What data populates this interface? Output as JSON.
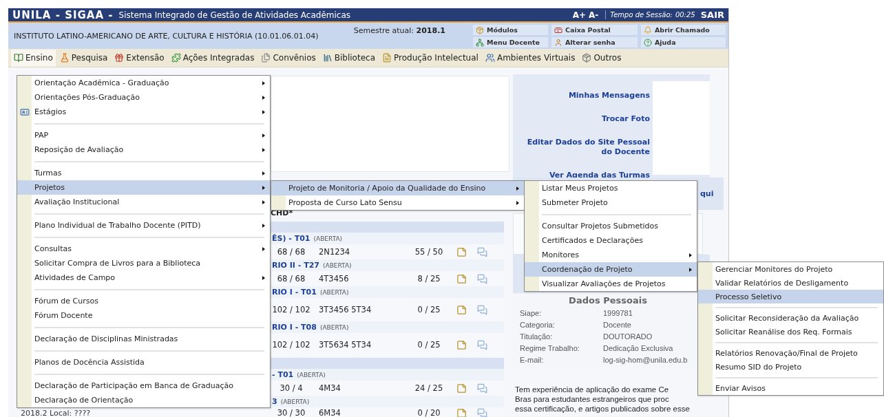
{
  "header": {
    "system": "UNILA - SIGAA -",
    "title": "Sistema Integrado de Gestão de Atividades Acadêmicas",
    "font_buttons": [
      "A+",
      "A-"
    ],
    "session_label": "Tempo de Sessão:",
    "session_time": "00:25",
    "logout": "SAIR"
  },
  "info_bar": {
    "unit": "INSTITUTO LATINO-AMERICANO DE ARTE, CULTURA E HISTÓRIA (10.01.06.01.04)",
    "semester_label": "Semestre atual:",
    "semester": "2018.1",
    "shortcuts": [
      "Módulos",
      "Caixa Postal",
      "Abrir Chamado",
      "Menu Docente",
      "Alterar senha",
      "Ajuda"
    ]
  },
  "menu_bar": [
    {
      "label": "Ensino",
      "selected": true
    },
    {
      "label": "Pesquisa",
      "selected": false
    },
    {
      "label": "Extensão",
      "selected": false
    },
    {
      "label": "Ações Integradas",
      "selected": false
    },
    {
      "label": "Convênios",
      "selected": false
    },
    {
      "label": "Biblioteca",
      "selected": false
    },
    {
      "label": "Produção Intelectual",
      "selected": false
    },
    {
      "label": "Ambientes Virtuais",
      "selected": false
    },
    {
      "label": "Outros",
      "selected": false
    }
  ],
  "table": {
    "header": "CHD*",
    "groups": [
      {
        "rows": [
          {
            "title": "ÊS) - T01",
            "status": "(ABERTA)",
            "hours": "68 / 68",
            "schedule": "2N1234",
            "seats": "55 / 50"
          },
          {
            "title": "RIO II - T27",
            "status": "(ABERTA)",
            "hours": "68 / 68",
            "schedule": "4T3456",
            "seats": "8 / 25"
          },
          {
            "title": "RIO I - T01",
            "status": "(ABERTA)",
            "hours": "102 / 102",
            "schedule": "3T3456 5T34",
            "seats": "0 / 25"
          },
          {
            "title": "RIO I - T08",
            "status": "(ABERTA)",
            "hours": "102 / 102",
            "schedule": "3T5634 5T34",
            "seats": "0 / 25"
          }
        ]
      },
      {
        "rows": [
          {
            "title": "- T01",
            "status": "(ABERTA)",
            "hours": "30 / 4",
            "schedule": "4M34",
            "seats": "24 / 25"
          },
          {
            "title": "3",
            "status": "(ABERTA)",
            "local": "2018.2 Local: ????",
            "hours": "30 / 30",
            "schedule": "6M34",
            "seats": "0 / 20"
          }
        ]
      }
    ]
  },
  "side_panel": {
    "links": [
      "Minhas Mensagens",
      "Trocar Foto",
      "Editar Dados do Site Pessoal do Docente",
      "Ver Agenda das Turmas"
    ],
    "partial_link": "qui",
    "personal_data": {
      "title": "Dados Pessoais",
      "fields": [
        {
          "label": "Siape:",
          "value": "1999781"
        },
        {
          "label": "Categoria:",
          "value": "Docente"
        },
        {
          "label": "Titulação:",
          "value": "DOUTORADO"
        },
        {
          "label": "Regime Trabalho:",
          "value": "Dedicação Exclusiva"
        },
        {
          "label": "E-mail:",
          "value": "log-sig-hom@unila.edu.b"
        }
      ]
    },
    "bio_lines": [
      "Tem experiência de aplicação do exame Ce",
      "Bras para estudantes estrangeiros que proc",
      "essa certificação, e artigos publicados sobre esse"
    ]
  },
  "ensino_menu": {
    "items": [
      {
        "kind": "item",
        "label": "Orientação Acadêmica - Graduação",
        "has_submenu": true,
        "selected": false
      },
      {
        "kind": "item",
        "label": "Orientações Pós-Graduação",
        "has_submenu": true,
        "selected": false
      },
      {
        "kind": "item",
        "label": "Estágios",
        "has_submenu": true,
        "selected": false,
        "has_icon": true
      },
      {
        "kind": "separator"
      },
      {
        "kind": "item",
        "label": "PAP",
        "has_submenu": true,
        "selected": false
      },
      {
        "kind": "item",
        "label": "Reposição de Avaliação",
        "has_submenu": true,
        "selected": false
      },
      {
        "kind": "separator"
      },
      {
        "kind": "item",
        "label": "Turmas",
        "has_submenu": true,
        "selected": false
      },
      {
        "kind": "item",
        "label": "Projetos",
        "has_submenu": true,
        "selected": true
      },
      {
        "kind": "item",
        "label": "Avaliação Institucional",
        "has_submenu": true,
        "selected": false
      },
      {
        "kind": "separator"
      },
      {
        "kind": "item",
        "label": "Plano Individual de Trabalho Docente (PITD)",
        "has_submenu": true,
        "selected": false
      },
      {
        "kind": "separator"
      },
      {
        "kind": "item",
        "label": "Consultas",
        "has_submenu": true,
        "selected": false
      },
      {
        "kind": "item",
        "label": "Solicitar Compra de Livros para a Biblioteca",
        "has_submenu": false,
        "selected": false
      },
      {
        "kind": "item",
        "label": "Atividades de Campo",
        "has_submenu": true,
        "selected": false
      },
      {
        "kind": "separator"
      },
      {
        "kind": "item",
        "label": "Fórum de Cursos",
        "has_submenu": false,
        "selected": false
      },
      {
        "kind": "item",
        "label": "Fórum Docente",
        "has_submenu": false,
        "selected": false
      },
      {
        "kind": "separator"
      },
      {
        "kind": "item",
        "label": "Declaração de Disciplinas Ministradas",
        "has_submenu": false,
        "selected": false
      },
      {
        "kind": "separator"
      },
      {
        "kind": "item",
        "label": "Planos de Docência Assistida",
        "has_submenu": false,
        "selected": false
      },
      {
        "kind": "separator"
      },
      {
        "kind": "item",
        "label": "Declaração de Participação em Banca de Graduação",
        "has_submenu": false,
        "selected": false
      },
      {
        "kind": "item",
        "label": "Declaração de Orientação",
        "has_submenu": false,
        "selected": false
      }
    ]
  },
  "projetos_menu": {
    "items": [
      {
        "kind": "item",
        "label": "Projeto de Monitoria / Apoio da Qualidade do Ensino",
        "has_submenu": true,
        "selected": true
      },
      {
        "kind": "item",
        "label": "Proposta de Curso Lato Sensu",
        "has_submenu": true,
        "selected": false
      }
    ]
  },
  "monitoria_menu": {
    "items": [
      {
        "kind": "item",
        "label": "Listar Meus Projetos",
        "has_submenu": false,
        "selected": false
      },
      {
        "kind": "item",
        "label": "Submeter Projeto",
        "has_submenu": false,
        "selected": false
      },
      {
        "kind": "separator"
      },
      {
        "kind": "item",
        "label": "Consultar Projetos Submetidos",
        "has_submenu": false,
        "selected": false
      },
      {
        "kind": "item",
        "label": "Certificados e Declarações",
        "has_submenu": false,
        "selected": false
      },
      {
        "kind": "item",
        "label": "Monitores",
        "has_submenu": true,
        "selected": false
      },
      {
        "kind": "item",
        "label": "Coordenação de Projeto",
        "has_submenu": true,
        "selected": true
      },
      {
        "kind": "item",
        "label": "Visualizar Avaliações de Projetos",
        "has_submenu": false,
        "selected": false
      }
    ]
  },
  "coordenacao_menu": {
    "items": [
      {
        "kind": "item",
        "label": "Gerenciar Monitores do Projeto",
        "has_submenu": false,
        "selected": false
      },
      {
        "kind": "item",
        "label": "Validar Relatórios de Desligamento",
        "has_submenu": false,
        "selected": false
      },
      {
        "kind": "item",
        "label": "Processo Seletivo",
        "has_submenu": false,
        "selected": true
      },
      {
        "kind": "separator"
      },
      {
        "kind": "item",
        "label": "Solicitar Reconsideração da Avaliação",
        "has_submenu": false,
        "selected": false
      },
      {
        "kind": "item",
        "label": "Solicitar Reanálise dos Req. Formais",
        "has_submenu": false,
        "selected": false
      },
      {
        "kind": "separator"
      },
      {
        "kind": "item",
        "label": "Relatórios Renovação/Final de Projeto",
        "has_submenu": false,
        "selected": false
      },
      {
        "kind": "item",
        "label": "Resumo SID do Projeto",
        "has_submenu": false,
        "selected": false
      },
      {
        "kind": "separator"
      },
      {
        "kind": "item",
        "label": "Enviar Avisos",
        "has_submenu": false,
        "selected": false
      }
    ]
  }
}
